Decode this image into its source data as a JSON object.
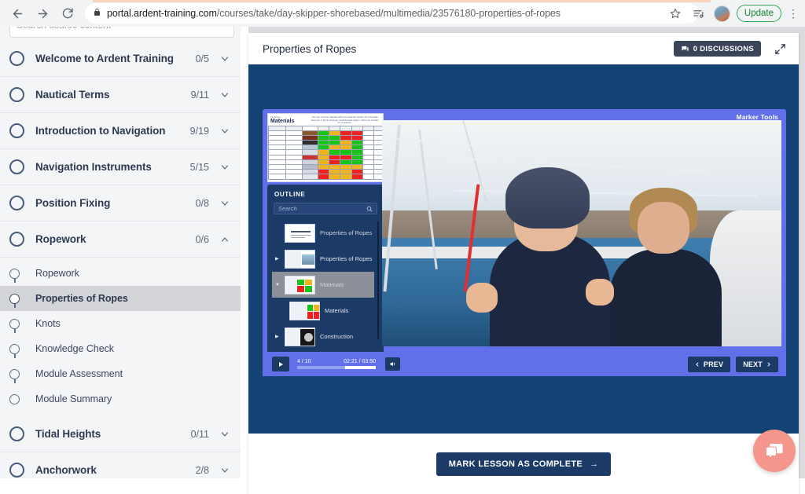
{
  "browser": {
    "url_domain": "portal.ardent-training.com",
    "url_path": "/courses/take/day-skipper-shorebased/multimedia/23576180-properties-of-ropes",
    "update_label": "Update",
    "back_icon": "back-arrow-icon",
    "forward_icon": "forward-arrow-icon",
    "reload_icon": "reload-icon",
    "lock_icon": "lock-icon",
    "bookmark_icon": "star-icon",
    "reading_list_icon": "reading-list-icon",
    "profile_icon": "profile-avatar",
    "menu_icon": "kebab-menu-icon"
  },
  "sidebar": {
    "search_placeholder": "Search course content",
    "sections": [
      {
        "title": "Welcome to Ardent Training",
        "count": "0/5",
        "expanded": false
      },
      {
        "title": "Nautical Terms",
        "count": "9/11",
        "expanded": false
      },
      {
        "title": "Introduction to Navigation",
        "count": "9/19",
        "expanded": false
      },
      {
        "title": "Navigation Instruments",
        "count": "5/15",
        "expanded": false
      },
      {
        "title": "Position Fixing",
        "count": "0/8",
        "expanded": false
      },
      {
        "title": "Ropework",
        "count": "0/6",
        "expanded": true
      }
    ],
    "ropework_lessons": [
      {
        "label": "Ropework",
        "active": false
      },
      {
        "label": "Properties of Ropes",
        "active": true
      },
      {
        "label": "Knots",
        "active": false
      },
      {
        "label": "Knowledge Check",
        "active": false
      },
      {
        "label": "Module Assessment",
        "active": false
      },
      {
        "label": "Module Summary",
        "active": false
      }
    ],
    "sections_after": [
      {
        "title": "Tidal Heights",
        "count": "0/11",
        "expanded": false
      },
      {
        "title": "Anchorwork",
        "count": "2/8",
        "expanded": false
      }
    ]
  },
  "main": {
    "lesson_title": "Properties of Ropes",
    "discussions_label": "0 DISCUSSIONS",
    "discussions_icon": "chat-bubble-icon",
    "expand_icon": "expand-fullscreen-icon",
    "complete_button": "MARK LESSON AS COMPLETE",
    "complete_arrow": "→"
  },
  "player": {
    "marker_tools_label": "Marker Tools",
    "outline_title": "OUTLINE",
    "search_placeholder": "Search",
    "search_icon": "magnifier-icon",
    "slide_title": "Materials",
    "slide_subtitle": "The most common materials which are should be familiar with in the table below are: H.M.P.E, Polyester, and Polyamide (Nylon). Others are included for comparison.",
    "outline_items": [
      {
        "label": "Properties of Ropes",
        "nested": false,
        "selected": false,
        "dim": true,
        "has_arrow": false
      },
      {
        "label": "Properties of Ropes",
        "nested": false,
        "selected": false,
        "dim": false,
        "has_arrow": true
      },
      {
        "label": "Materials",
        "nested": false,
        "selected": true,
        "dim": false,
        "has_arrow": true
      },
      {
        "label": "Materials",
        "nested": true,
        "selected": false,
        "dim": false,
        "has_arrow": false
      },
      {
        "label": "Construction",
        "nested": false,
        "selected": false,
        "dim": false,
        "has_arrow": true
      }
    ],
    "controls": {
      "play_icon": "play-icon",
      "volume_icon": "volume-icon",
      "slide_counter": "4 / 10",
      "time": "02:21 / 03:50",
      "progress_percent": 61,
      "prev_label": "PREV",
      "next_label": "NEXT",
      "prev_icon": "chevron-left-icon",
      "next_icon": "chevron-right-icon"
    }
  },
  "chat": {
    "icon": "chat-widget-icon",
    "color": "#f4968c"
  },
  "colors": {
    "stage_navy": "#154275",
    "player_purple": "#6170e8",
    "outline_blue": "#1c3a66",
    "accent_button": "#1c3a66"
  }
}
